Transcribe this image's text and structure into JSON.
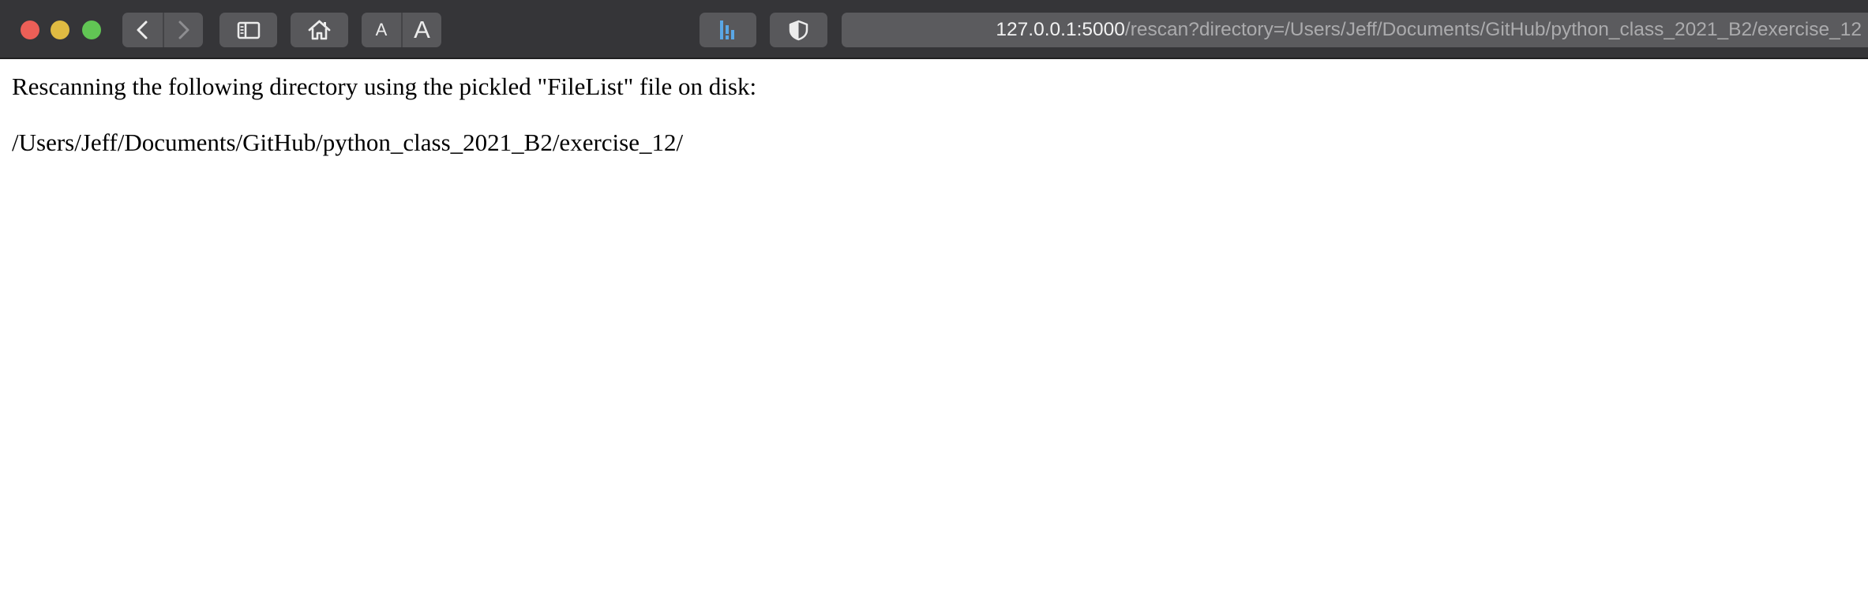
{
  "toolbar": {
    "font_small_label": "A",
    "font_large_label": "A"
  },
  "address_bar": {
    "host": "127.0.0.1:5000",
    "path": "/rescan?directory=/Users/Jeff/Documents/GitHub/python_class_2021_B2/exercise_12"
  },
  "page": {
    "message": "Rescanning the following directory using the pickled \"FileList\" file on disk:",
    "directory": "/Users/Jeff/Documents/GitHub/python_class_2021_B2/exercise_12/"
  },
  "icons": {
    "back": "chevron-left-icon",
    "forward": "chevron-right-icon",
    "sidebar": "sidebar-icon",
    "home": "home-icon",
    "extension": "extension-icon",
    "shield": "shield-icon"
  },
  "colors": {
    "toolbar_bg": "#353538",
    "button_bg": "#58585b",
    "close": "#ec5f57",
    "minimize": "#e0bb42",
    "maximize": "#61c554",
    "extension_accent": "#5aa7e6"
  }
}
